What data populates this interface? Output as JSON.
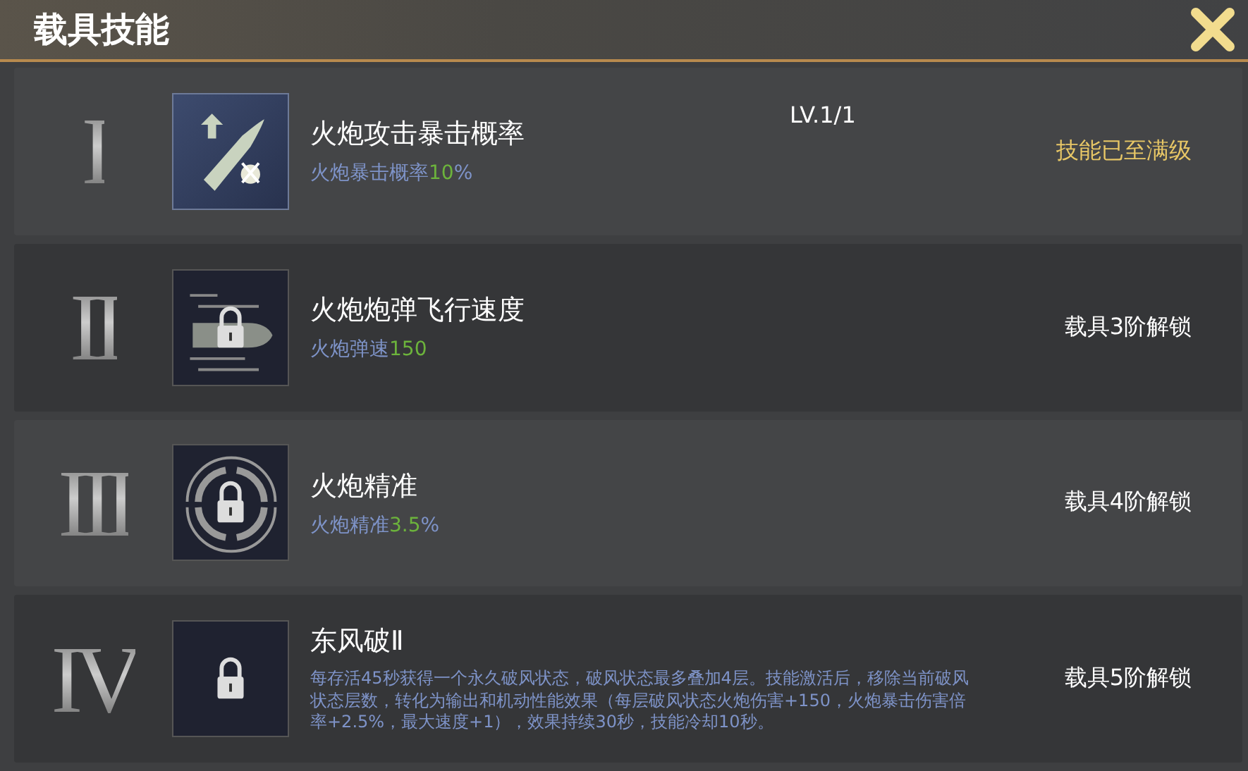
{
  "header": {
    "title": "载具技能"
  },
  "skills": [
    {
      "numeral": "I",
      "kind": "crit",
      "locked": false,
      "name": "火炮攻击暴击概率",
      "level": "LV.1/1",
      "desc_label": "火炮暴击概率",
      "desc_value": "10",
      "desc_unit": "%",
      "status": "技能已至满级"
    },
    {
      "numeral": "II",
      "kind": "velocity",
      "locked": true,
      "name": "火炮炮弹飞行速度",
      "desc_label": "火炮弹速",
      "desc_value": "150",
      "status": "载具3阶解锁"
    },
    {
      "numeral": "III",
      "kind": "accuracy",
      "locked": true,
      "name": "火炮精准",
      "desc_label": "火炮精准",
      "desc_value": "3.5",
      "desc_unit": "%",
      "status": "载具4阶解锁"
    },
    {
      "numeral": "IV",
      "kind": "blank",
      "locked": true,
      "name": "东风破Ⅱ",
      "desc_label": "每存活45秒获得一个永久破风状态，破风状态最多叠加4层。技能激活后，移除当前破风状态层数，转化为输出和机动性能效果（每层破风状态火炮伤害+150，火炮暴击伤害倍率+2.5%，最大速度+1），效果持续30秒，技能冷却10秒。",
      "status": "载具5阶解锁"
    }
  ]
}
